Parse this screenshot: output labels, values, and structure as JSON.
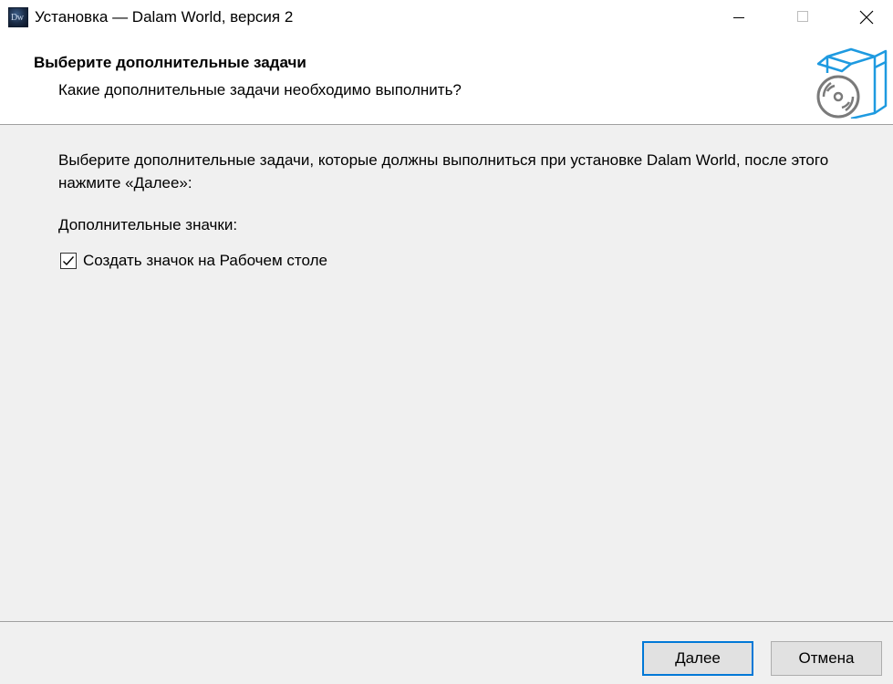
{
  "window": {
    "title": "Установка — Dalam World, версия 2",
    "icon_text": "Dw"
  },
  "header": {
    "title": "Выберите дополнительные задачи",
    "subtitle": "Какие дополнительные задачи необходимо выполнить?"
  },
  "body": {
    "description": "Выберите дополнительные задачи, которые должны выполниться при установке Dalam World, после этого нажмите «Далее»:",
    "group_label": "Дополнительные значки:",
    "tasks": [
      {
        "label": "Создать значок на Рабочем столе",
        "checked": true
      }
    ]
  },
  "footer": {
    "next_label": "Далее",
    "cancel_label": "Отмена"
  },
  "colors": {
    "accent": "#0078d7",
    "header_bg": "#ffffff",
    "body_bg": "#f0f0f0",
    "button_bg": "#e1e1e1"
  }
}
